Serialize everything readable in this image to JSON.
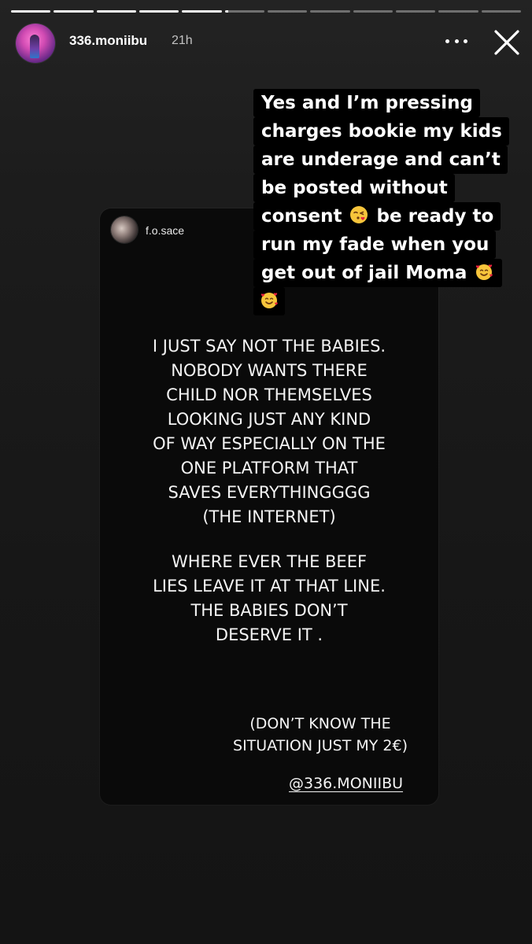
{
  "story": {
    "segments_total": 12,
    "segments_done": 5,
    "current_segment_progress": 0.08,
    "colors": {
      "background": "#1b1b1b",
      "card": "#0a0a0a",
      "caption_bg": "#000000",
      "text": "#ffffff"
    }
  },
  "header": {
    "avatar_icon": "profile-avatar",
    "username": "336.moniibu",
    "time_ago": "21h",
    "more_icon": "more-horizontal-icon",
    "close_icon": "close-icon"
  },
  "shared_post": {
    "avatar_icon": "post-author-avatar",
    "username": "f.o.sace",
    "paragraph_1": "I JUST SAY NOT THE BABIES.\nNOBODY WANTS THERE\nCHILD NOR THEMSELVES\nLOOKING JUST ANY KIND\nOF WAY ESPECIALLY ON THE\nONE PLATFORM THAT\nSAVES EVERYTHINGGGG\n(THE INTERNET)",
    "paragraph_2": "WHERE EVER THE BEEF\nLIES LEAVE IT AT THAT LINE.\nTHE BABIES DON’T\nDESERVE IT .",
    "note": "(DON’T KNOW THE\nSITUATION JUST MY 2€)",
    "mention": "@336.MONIIBU"
  },
  "caption": {
    "lines": [
      "Yes and I’m pressing",
      "charges bookie my kids",
      "are underage and can’t",
      "be posted without",
      "consent",
      "be ready to",
      "run my fade when you",
      "get out of jail Moma"
    ],
    "emojis": [
      "face-blowing-kiss-emoji",
      "smiling-face-with-hearts-emoji"
    ]
  }
}
